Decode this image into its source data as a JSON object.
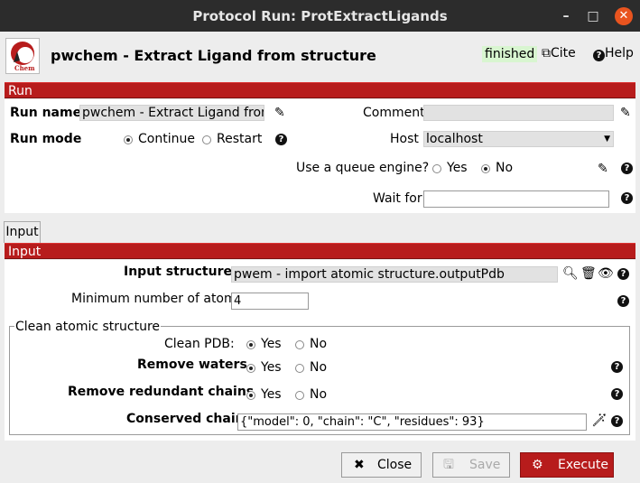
{
  "window": {
    "title": "Protocol Run: ProtExtractLigands",
    "minimize": "–",
    "maximize": "□",
    "close": "✕"
  },
  "header": {
    "logo_text": "Chem",
    "protocol_name": "pwchem - Extract Ligand from structure",
    "status": "finished",
    "cite_label": "Cite",
    "help_label": "Help"
  },
  "run_section": {
    "title": "Run",
    "run_name_label": "Run name",
    "run_name_value": "pwchem - Extract Ligand from st",
    "comment_label": "Comment",
    "comment_value": "",
    "run_mode_label": "Run mode",
    "run_mode_options": [
      "Continue",
      "Restart"
    ],
    "run_mode_selected": "Continue",
    "host_label": "Host",
    "host_value": "localhost",
    "queue_label": "Use a queue engine?",
    "queue_options": [
      "Yes",
      "No"
    ],
    "queue_selected": "No",
    "wait_for_label": "Wait for",
    "wait_for_value": ""
  },
  "tabs": [
    "Input"
  ],
  "input_section": {
    "title": "Input",
    "input_structure_label": "Input structure:",
    "input_structure_value": "pwem - import atomic structure.outputPdb",
    "min_atoms_label": "Minimum number of atoms:",
    "min_atoms_value": "4",
    "group_title": "Clean atomic structure",
    "clean_pdb_label": "Clean PDB:",
    "remove_waters_label": "Remove waters",
    "remove_redundant_label": "Remove redundant chains",
    "conserved_chain_label": "Conserved chain",
    "conserved_chain_value": "{\"model\": 0, \"chain\": \"C\", \"residues\": 93}",
    "yes": "Yes",
    "no": "No"
  },
  "footer": {
    "close_label": "Close",
    "save_label": "Save",
    "execute_label": "Execute"
  },
  "colors": {
    "accent_red": "#b71c1c",
    "status_green": "#d8f5d0",
    "titlebar": "#2c2c2c",
    "close_orange": "#e9541f"
  }
}
